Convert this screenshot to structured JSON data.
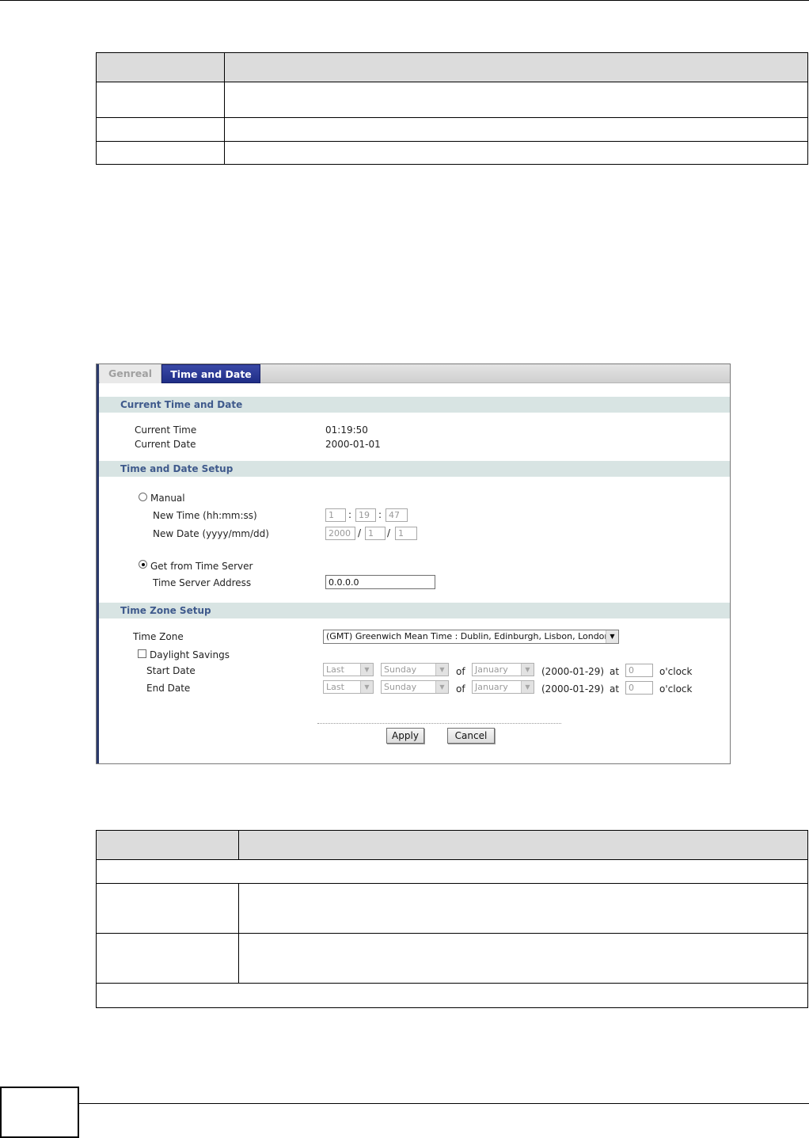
{
  "panel": {
    "tabs": [
      {
        "label": "Genreal",
        "active": false
      },
      {
        "label": "Time and Date",
        "active": true
      }
    ],
    "sections": {
      "current": "Current Time and Date",
      "setup": "Time and Date Setup",
      "zone": "Time Zone Setup"
    },
    "current_time_label": "Current Time",
    "current_time_value": "01:19:50",
    "current_date_label": "Current Date",
    "current_date_value": "2000-01-01",
    "manual_label": "Manual",
    "new_time_label": "New Time (hh:mm:ss)",
    "new_time": {
      "hh": "1",
      "mm": "19",
      "ss": "47",
      "sep": ":"
    },
    "new_date_label": "New Date (yyyy/mm/dd)",
    "new_date": {
      "yyyy": "2000",
      "mm": "1",
      "dd": "1",
      "sep": "/"
    },
    "server_label": "Get from Time Server",
    "server_address_label": "Time Server Address",
    "server_address_value": "0.0.0.0",
    "time_zone_label": "Time Zone",
    "time_zone_value": "(GMT) Greenwich Mean Time : Dublin, Edinburgh, Lisbon, London",
    "daylight_label": "Daylight Savings",
    "start_label": "Start Date",
    "end_label": "End Date",
    "dst_row": {
      "week": "Last",
      "day": "Sunday",
      "of": "of",
      "month": "January",
      "date": "(2000-01-29)",
      "at": "at",
      "hour": "0",
      "oclock": "o'clock"
    },
    "apply_label": "Apply",
    "cancel_label": "Cancel",
    "manual_selected": false,
    "server_selected": true,
    "daylight_checked": false
  }
}
